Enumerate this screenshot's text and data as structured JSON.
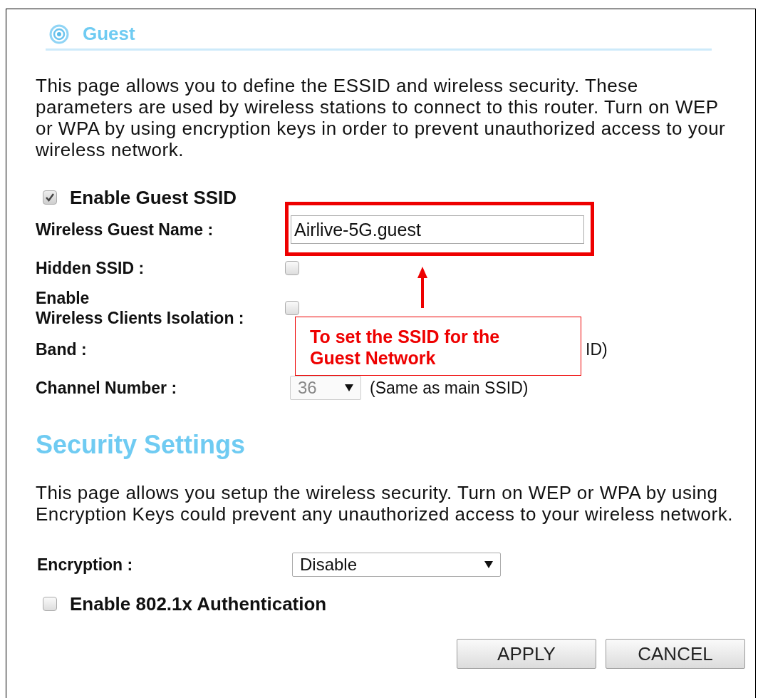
{
  "header": {
    "title": "Guest"
  },
  "intro": "This page allows you to define the ESSID and wireless security. These\nparameters are used by wireless stations to connect to this router.  Turn on WEP\nor WPA by using encryption keys in order to prevent unauthorized access to your\nwireless network.",
  "guest": {
    "enable": {
      "label": "Enable Guest SSID",
      "checked": true
    },
    "rows": [
      {
        "kind": "text",
        "label": "Wireless Guest Name :",
        "value": "Airlive-5G.guest"
      },
      {
        "kind": "checkbox",
        "label": "Hidden SSID :",
        "checked": false
      },
      {
        "kind": "checkbox",
        "label": "Enable\nWireless Clients Isolation :",
        "checked": false
      },
      {
        "kind": "note",
        "label": "Band :",
        "note": "ID)"
      },
      {
        "kind": "select",
        "label": "Channel Number :",
        "value": "36",
        "disabled": true,
        "note": "(Same as main SSID)"
      }
    ]
  },
  "security": {
    "title": "Security Settings",
    "text": "This page allows you setup the wireless security. Turn on WEP or WPA by using\nEncryption Keys could prevent any unauthorized access to your wireless network.",
    "encryption": {
      "label": "Encryption :",
      "value": "Disable"
    },
    "auth": {
      "label": "Enable 802.1x Authentication",
      "checked": false
    }
  },
  "buttons": [
    "APPLY",
    "CANCEL"
  ],
  "annotation": {
    "text": "To set the SSID for the Guest Network"
  }
}
